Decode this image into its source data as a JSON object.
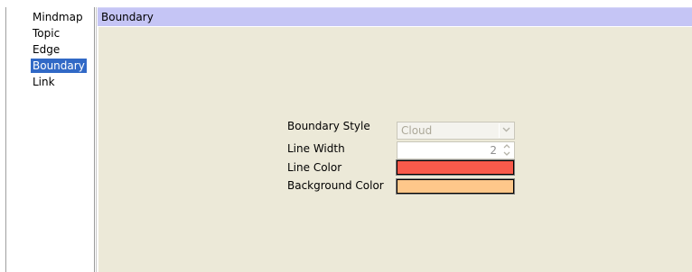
{
  "sidebar": {
    "items": [
      {
        "label": "Mindmap",
        "selected": false
      },
      {
        "label": "Topic",
        "selected": false
      },
      {
        "label": "Edge",
        "selected": false
      },
      {
        "label": "Boundary",
        "selected": true
      },
      {
        "label": "Link",
        "selected": false
      }
    ]
  },
  "panel": {
    "title": "Boundary"
  },
  "form": {
    "boundary_style": {
      "label": "Boundary Style",
      "value": "Cloud",
      "enabled": false
    },
    "line_width": {
      "label": "Line Width",
      "value": "2"
    },
    "line_color": {
      "label": "Line Color",
      "color": "#f95a4b"
    },
    "background_color": {
      "label": "Background Color",
      "color": "#fec78a"
    }
  },
  "colors": {
    "selection": "#3169c6",
    "header": "#c5c5f5",
    "panel_background": "#ece9d8"
  },
  "icons": {
    "combo_arrow": "chevron-down-icon",
    "spin_up": "chevron-up-icon",
    "spin_down": "chevron-down-icon"
  }
}
